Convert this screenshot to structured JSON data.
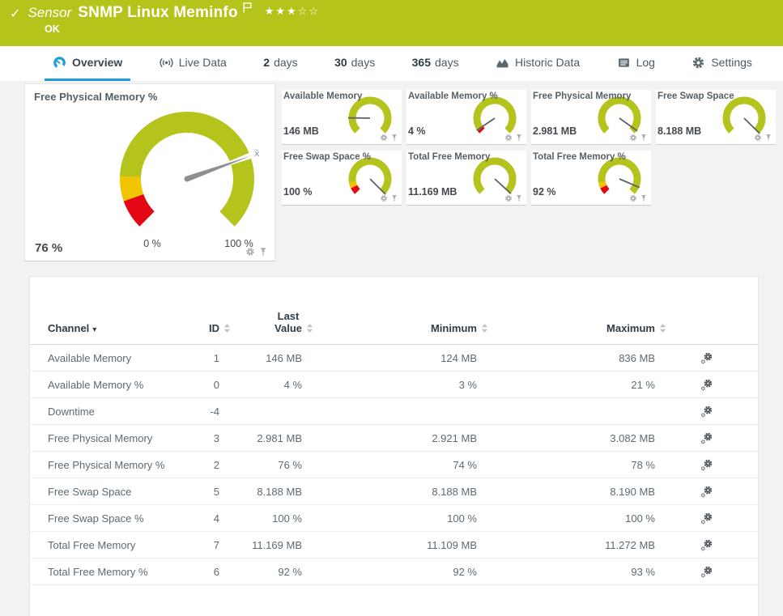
{
  "colors": {
    "header_green": "#b5c41a",
    "gauge_green": "#b4c41c",
    "gauge_yellow": "#f0c400",
    "gauge_red": "#e30613",
    "active_tab_blue": "#1e9cd8",
    "needle_gray": "#909090"
  },
  "header": {
    "check_icon": "✓",
    "kind_label": "Sensor",
    "title": "SNMP Linux Meminfo",
    "status": "OK",
    "stars_filled": 3,
    "stars_total": 5
  },
  "tabs": [
    {
      "label": "Overview",
      "icon": "gauge-icon",
      "active": true
    },
    {
      "label": "Live Data",
      "icon": "broadcast-icon",
      "active": false
    },
    {
      "prefix": "2",
      "label": "days",
      "active": false
    },
    {
      "prefix": "30",
      "label": "days",
      "active": false
    },
    {
      "prefix": "365",
      "label": "days",
      "active": false
    },
    {
      "label": "Historic Data",
      "icon": "historic-chart-icon",
      "active": false
    },
    {
      "label": "Log",
      "icon": "log-icon",
      "active": false
    },
    {
      "label": "Settings",
      "icon": "gear-icon",
      "active": false
    }
  ],
  "big_gauge": {
    "title": "Free Physical Memory %",
    "value_label": "76 %",
    "scale_min_label": "0 %",
    "scale_max_label": "100 %",
    "avg_marker_label": "x̄",
    "fraction": 0.76,
    "segments": [
      {
        "from": 0,
        "to": 0.095,
        "color": "#e30613"
      },
      {
        "from": 0.095,
        "to": 0.175,
        "color": "#f0c400"
      },
      {
        "from": 0.175,
        "to": 1,
        "color": "#b4c41c"
      },
      {
        "from": 0.749,
        "to": 0.768,
        "color": "#ffffff"
      }
    ]
  },
  "small_gauges": [
    {
      "title": "Available Memory",
      "value_label": "146 MB",
      "fraction": 0.17,
      "segments": [
        {
          "from": 0,
          "to": 1,
          "color": "#b4c41c"
        }
      ]
    },
    {
      "title": "Available Memory %",
      "value_label": "4 %",
      "fraction": 0.04,
      "segments": [
        {
          "from": 0,
          "to": 0.03,
          "color": "#e30613"
        },
        {
          "from": 0.03,
          "to": 1,
          "color": "#b4c41c"
        }
      ]
    },
    {
      "title": "Free Physical Memory",
      "value_label": "2.981 MB",
      "fraction": 0.965,
      "segments": [
        {
          "from": 0,
          "to": 1,
          "color": "#b4c41c"
        }
      ]
    },
    {
      "title": "Free Swap Space",
      "value_label": "8.188 MB",
      "fraction": 0.999,
      "segments": [
        {
          "from": 0,
          "to": 1,
          "color": "#b4c41c"
        }
      ]
    },
    {
      "title": "Free Swap Space %",
      "value_label": "100 %",
      "fraction": 1.0,
      "segments": [
        {
          "from": 0,
          "to": 0.07,
          "color": "#e30613"
        },
        {
          "from": 0.07,
          "to": 0.13,
          "color": "#f0c400"
        },
        {
          "from": 0.13,
          "to": 1,
          "color": "#b4c41c"
        }
      ]
    },
    {
      "title": "Total Free Memory",
      "value_label": "11.169 MB",
      "fraction": 0.99,
      "segments": [
        {
          "from": 0,
          "to": 1,
          "color": "#b4c41c"
        }
      ]
    },
    {
      "title": "Total Free Memory %",
      "value_label": "92 %",
      "fraction": 0.92,
      "segments": [
        {
          "from": 0,
          "to": 0.07,
          "color": "#e30613"
        },
        {
          "from": 0.07,
          "to": 0.13,
          "color": "#f0c400"
        },
        {
          "from": 0.13,
          "to": 1,
          "color": "#b4c41c"
        }
      ]
    }
  ],
  "table": {
    "columns": [
      {
        "label": "Channel",
        "sorted": true
      },
      {
        "label": "ID",
        "sorted": false
      },
      {
        "label": "Last Value",
        "sorted": false,
        "two_line": true
      },
      {
        "label": "Minimum",
        "sorted": false
      },
      {
        "label": "Maximum",
        "sorted": false
      }
    ],
    "rows": [
      {
        "channel": "Available Memory",
        "id": "1",
        "last": "146 MB",
        "min": "124 MB",
        "max": "836 MB"
      },
      {
        "channel": "Available Memory %",
        "id": "0",
        "last": "4 %",
        "min": "3 %",
        "max": "21 %"
      },
      {
        "channel": "Downtime",
        "id": "-4",
        "last": "",
        "min": "",
        "max": ""
      },
      {
        "channel": "Free Physical Memory",
        "id": "3",
        "last": "2.981 MB",
        "min": "2.921 MB",
        "max": "3.082 MB"
      },
      {
        "channel": "Free Physical Memory %",
        "id": "2",
        "last": "76 %",
        "min": "74 %",
        "max": "78 %"
      },
      {
        "channel": "Free Swap Space",
        "id": "5",
        "last": "8.188 MB",
        "min": "8.188 MB",
        "max": "8.190 MB"
      },
      {
        "channel": "Free Swap Space %",
        "id": "4",
        "last": "100 %",
        "min": "100 %",
        "max": "100 %"
      },
      {
        "channel": "Total Free Memory",
        "id": "7",
        "last": "11.169 MB",
        "min": "11.109 MB",
        "max": "11.272 MB"
      },
      {
        "channel": "Total Free Memory %",
        "id": "6",
        "last": "92 %",
        "min": "92 %",
        "max": "93 %"
      }
    ]
  }
}
